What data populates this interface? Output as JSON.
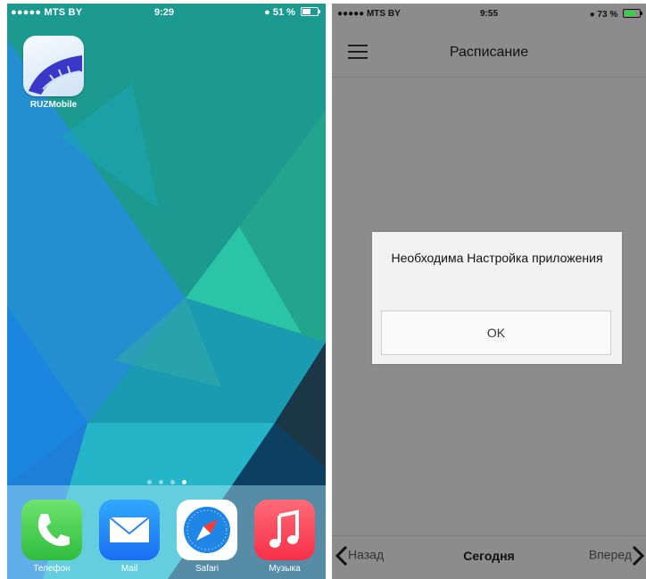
{
  "left_screen": {
    "status_bar": {
      "carrier": "●●●●● MTS BY",
      "time": "9:29",
      "battery": "51 %",
      "battery_level": 0.51
    },
    "home_apps": [
      {
        "label": "RUZMobile",
        "icon": "ruzmobile-app-icon"
      }
    ],
    "page_indicator": {
      "count": 4,
      "active": 4
    },
    "dock": [
      {
        "label": "Телефон",
        "icon": "phone-icon",
        "color": "#3ccd4a"
      },
      {
        "label": "Mail",
        "icon": "mail-icon",
        "color": "#2b86f0"
      },
      {
        "label": "Safari",
        "icon": "safari-icon",
        "color": "#ffffff"
      },
      {
        "label": "Музыка",
        "icon": "music-icon",
        "color": "#fa4a57"
      }
    ]
  },
  "right_screen": {
    "status_bar": {
      "carrier": "●●●●● MTS BY",
      "time": "9:55",
      "battery": "73 %",
      "battery_level": 0.73
    },
    "title": "Расписание",
    "dialog": {
      "message": "Необходима Настройка приложения",
      "ok_label": "OK"
    },
    "bottom_bar": {
      "back_label": "Назад",
      "today_label": "Сегодня",
      "forward_label": "Вперед"
    }
  }
}
